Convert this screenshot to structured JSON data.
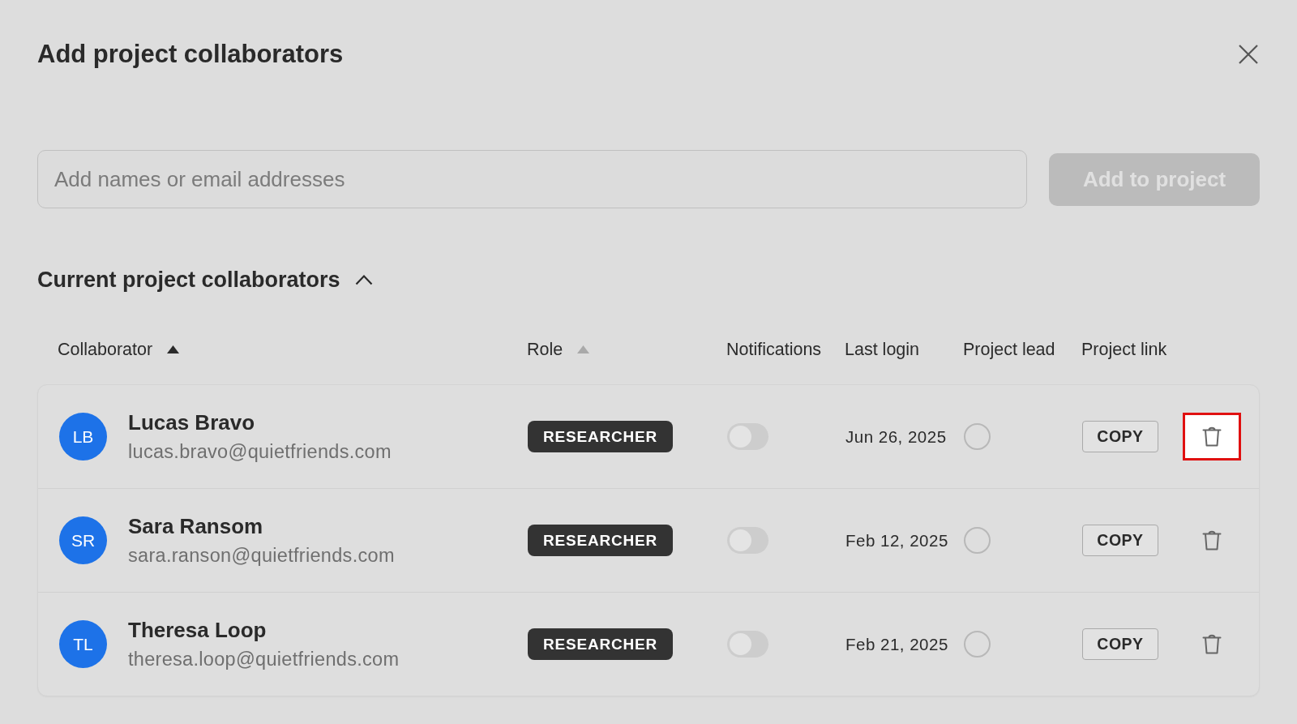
{
  "dialog": {
    "title": "Add project collaborators"
  },
  "invite": {
    "placeholder": "Add names or email addresses",
    "add_button": {
      "label": "Add to project",
      "disabled": true
    }
  },
  "collaborators_section": {
    "title": "Current project collaborators",
    "expanded": true
  },
  "table": {
    "columns": [
      {
        "label": "Collaborator",
        "kind": "sortable",
        "sorted": true
      },
      {
        "label": "Role",
        "kind": "sortable",
        "sorted": false
      },
      {
        "label": "Notifications",
        "kind": "plain"
      },
      {
        "label": "Last login",
        "kind": "plain"
      },
      {
        "label": "Project lead",
        "kind": "plain"
      },
      {
        "label": "Project link",
        "kind": "plain"
      }
    ],
    "rows": [
      {
        "initials": "LB",
        "name": "Lucas Bravo",
        "email": "lucas.bravo@quietfriends.com",
        "role": "RESEARCHER",
        "notifications": false,
        "last_login": "Jun 26, 2025",
        "project_lead": false,
        "link_button": "COPY",
        "delete_highlighted": true
      },
      {
        "initials": "SR",
        "name": "Sara Ransom",
        "email": "sara.ranson@quietfriends.com",
        "role": "RESEARCHER",
        "notifications": false,
        "last_login": "Feb 12, 2025",
        "project_lead": false,
        "link_button": "COPY",
        "delete_highlighted": false
      },
      {
        "initials": "TL",
        "name": "Theresa Loop",
        "email": "theresa.loop@quietfriends.com",
        "role": "RESEARCHER",
        "notifications": false,
        "last_login": "Feb 21, 2025",
        "project_lead": false,
        "link_button": "COPY",
        "delete_highlighted": false
      }
    ]
  }
}
